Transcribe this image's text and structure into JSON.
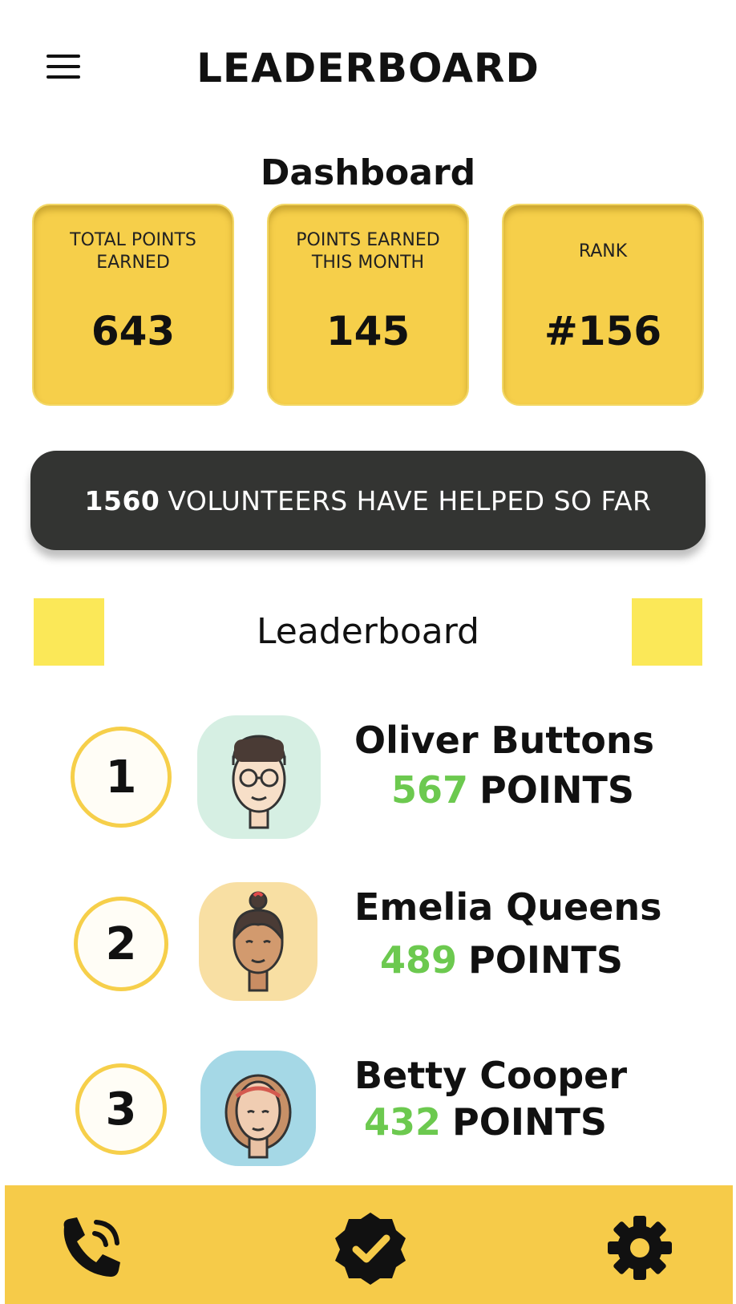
{
  "header": {
    "title": "LEADERBOARD"
  },
  "dashboard": {
    "title": "Dashboard",
    "cards": [
      {
        "label": "TOTAL POINTS EARNED",
        "value": "643"
      },
      {
        "label": "POINTS EARNED THIS MONTH",
        "value": "145"
      },
      {
        "label": "RANK",
        "value": "#156"
      }
    ]
  },
  "banner": {
    "count": "1560",
    "text": "VOLUNTEERS HAVE HELPED SO FAR"
  },
  "leaderboard": {
    "title": "Leaderboard",
    "rows": [
      {
        "rank": "1",
        "name": "Oliver Buttons",
        "points": "567",
        "points_label": "POINTS",
        "avatar_bg": "#d6efe3"
      },
      {
        "rank": "2",
        "name": "Emelia Queens",
        "points": "489",
        "points_label": "POINTS",
        "avatar_bg": "#f8dfa3"
      },
      {
        "rank": "3",
        "name": "Betty Cooper",
        "points": "432",
        "points_label": "POINTS",
        "avatar_bg": "#a5d8e6"
      }
    ]
  },
  "nav": {
    "items": [
      "phone-icon",
      "verified-badge-icon",
      "settings-gear-icon"
    ]
  },
  "colors": {
    "accent_yellow": "#f6cf4a",
    "points_green": "#6cc94f",
    "banner_dark": "#333432"
  }
}
